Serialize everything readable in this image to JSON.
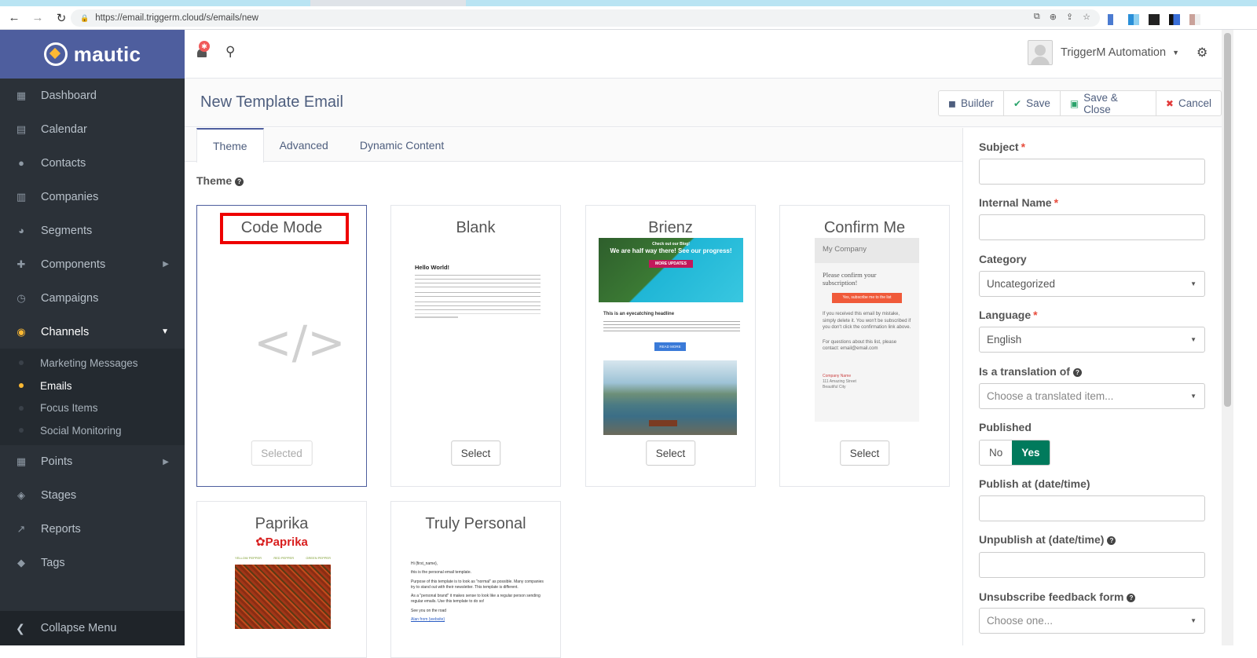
{
  "browser": {
    "url": "https://email.triggerm.cloud/s/emails/new"
  },
  "brand": {
    "name": "mautic"
  },
  "sidebar": {
    "items": [
      {
        "label": "Dashboard",
        "icon": "dashboard-icon"
      },
      {
        "label": "Calendar",
        "icon": "calendar-icon"
      },
      {
        "label": "Contacts",
        "icon": "contacts-icon"
      },
      {
        "label": "Companies",
        "icon": "companies-icon"
      },
      {
        "label": "Segments",
        "icon": "segments-icon"
      },
      {
        "label": "Components",
        "icon": "puzzle-icon"
      },
      {
        "label": "Campaigns",
        "icon": "campaigns-icon"
      },
      {
        "label": "Channels",
        "icon": "rss-icon"
      }
    ],
    "channels_sub": [
      "Marketing Messages",
      "Emails",
      "Focus Items",
      "Social Monitoring"
    ],
    "items_after": [
      {
        "label": "Points",
        "icon": "calculator-icon"
      },
      {
        "label": "Stages",
        "icon": "stages-icon"
      },
      {
        "label": "Reports",
        "icon": "chart-icon"
      },
      {
        "label": "Tags",
        "icon": "tag-icon"
      }
    ],
    "collapse_label": "Collapse Menu"
  },
  "topbar": {
    "notification_count": "",
    "user_name": "TriggerM Automation"
  },
  "header": {
    "title": "New Template Email",
    "buttons": {
      "builder": "Builder",
      "save": "Save",
      "save_close": "Save & Close",
      "cancel": "Cancel"
    }
  },
  "tabs": [
    "Theme",
    "Advanced",
    "Dynamic Content"
  ],
  "theme_label": "Theme",
  "themes": [
    {
      "name": "Code Mode",
      "button": "Selected"
    },
    {
      "name": "Blank",
      "button": "Select"
    },
    {
      "name": "Brienz",
      "button": "Select"
    },
    {
      "name": "Confirm Me",
      "button": "Select"
    },
    {
      "name": "Paprika",
      "button": "Select"
    },
    {
      "name": "Truly Personal",
      "button": "Select"
    }
  ],
  "thumbs": {
    "blank_heading": "Hello World!",
    "brienz_banner_small": "Check out our Blog!",
    "brienz_banner": "We are half way there! See our progress!",
    "brienz_banner_btn": "MORE UPDATES",
    "brienz_headline": "This is an eyecatching headline",
    "brienz_btn": "READ MORE",
    "confirm_company": "My Company",
    "confirm_question": "Please confirm your subscription!",
    "confirm_btn": "Yes, subscribe me to the list",
    "confirm_body": "If you received this email by mistake, simply delete it. You won't be subscribed if you don't click the confirmation link above.",
    "confirm_questions": "For questions about this list, please contact: email@email.com",
    "confirm_addr_name": "Company Name",
    "confirm_addr_street": "111 Amazing Street",
    "confirm_addr_city": "Beautiful City",
    "paprika_logo": "✿Paprika",
    "paprika_nav": [
      "YELLOW PEPPER",
      "RED PEPPER",
      "GREEN PEPPER"
    ],
    "personal_lines": [
      "Hi {first_name},",
      "this is the personal email template.",
      "Purpose of this template is to look as \"normal\" as possible. Many companies try to stand out with their newsletter. This template is different.",
      "As a \"personal brand\" it makes sense to look like a regular person sending regular emails. Use this template to do so!",
      "See you on the road",
      "Alan from {website}"
    ]
  },
  "form": {
    "subject_label": "Subject",
    "subject_value": "",
    "internal_name_label": "Internal Name",
    "internal_name_value": "",
    "category_label": "Category",
    "category_value": "Uncategorized",
    "language_label": "Language",
    "language_value": "English",
    "translation_label": "Is a translation of",
    "translation_placeholder": "Choose a translated item...",
    "published_label": "Published",
    "published_no": "No",
    "published_yes": "Yes",
    "publish_at_label": "Publish at (date/time)",
    "publish_at_value": "",
    "unpublish_at_label": "Unpublish at (date/time)",
    "unpublish_at_value": "",
    "unsubscribe_label": "Unsubscribe feedback form",
    "unsubscribe_placeholder": "Choose one..."
  },
  "colors": {
    "brand": "#4e5e9e",
    "sidebar": "#2b3138",
    "accent": "#fdb933",
    "published_on": "#007a5c",
    "highlight": "#ee0000"
  }
}
